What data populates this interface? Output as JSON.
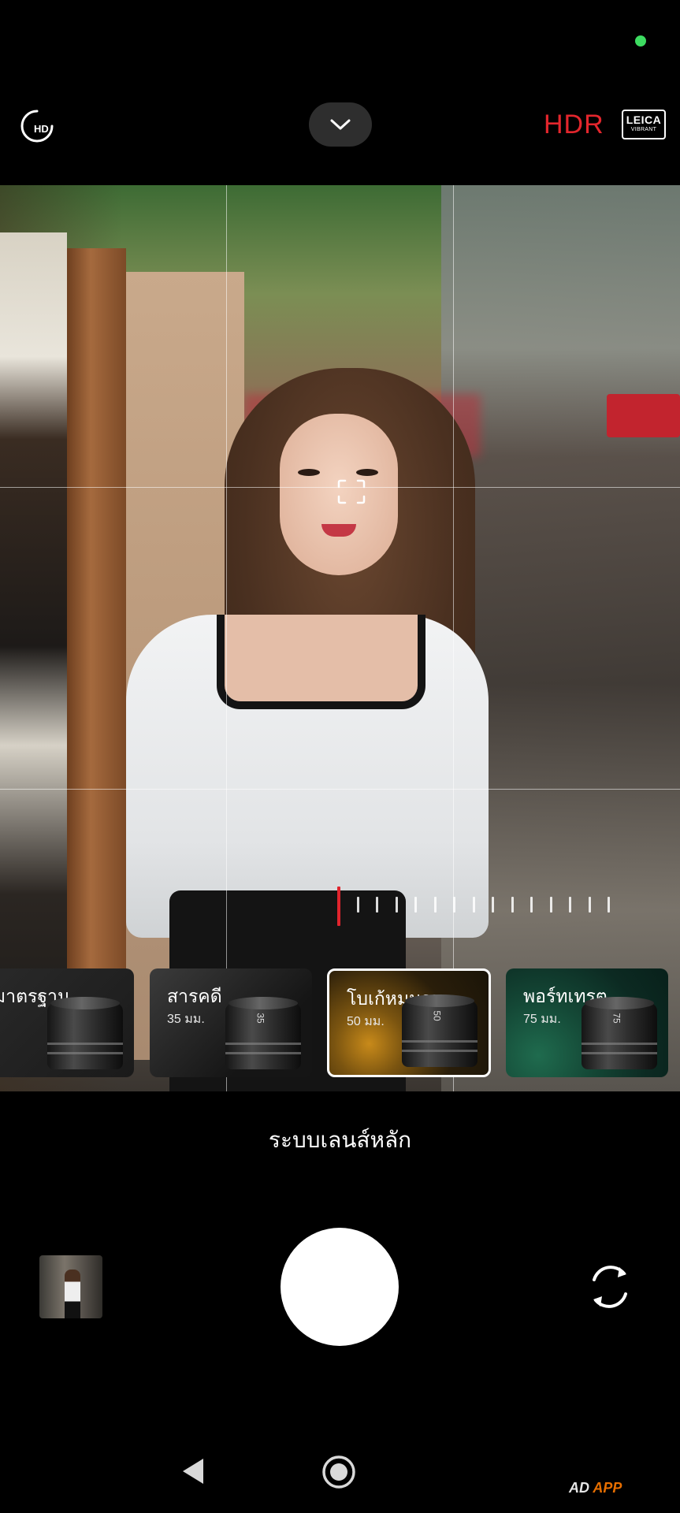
{
  "colors": {
    "status_dot": "#3ddc61",
    "hdr_active": "#e3262d",
    "zoom_indicator": "#e0242d",
    "selected_border": "#ffffff"
  },
  "top_bar": {
    "hd_icon_text": "HD",
    "hdr_label": "HDR",
    "leica_brand": "LEICA",
    "leica_mode": "VIBRANT"
  },
  "lenses": [
    {
      "name": "มาตรฐาน",
      "focal": "",
      "lens_mark": "",
      "bg": "linear-gradient(135deg,#2a2a2a,#1a1a1a)"
    },
    {
      "name": "สารคดี",
      "focal": "35 มม.",
      "lens_mark": "35",
      "bg": "linear-gradient(135deg,#3b3b3b,#151515 70%)"
    },
    {
      "name": "โบเก้หมุนวน",
      "focal": "50 มม.",
      "lens_mark": "50",
      "bg": "radial-gradient(circle at 25% 70%,#c88a1a 0,#7a5410 25%,#2a1e0a 60%,#1a1408)"
    },
    {
      "name": "พอร์ทเทรต",
      "focal": "75 มม.",
      "lens_mark": "75",
      "bg": "radial-gradient(circle at 20% 80%,#1f6b4e 0,#144836 35%,#0c2a22 70%,#08201a)"
    }
  ],
  "selected_lens_index": 2,
  "mode_label": "ระบบเลนส์หลัก",
  "zoom": {
    "tick_count": 15,
    "active_tick": 0
  },
  "watermark": {
    "prefix": "AD",
    "suffix": "APP"
  },
  "icons": {
    "hd": "hd-quality-icon",
    "chevron": "chevron-down-icon",
    "focus": "focus-frame-icon",
    "flip": "switch-camera-icon",
    "back": "nav-back-icon",
    "home": "nav-home-icon"
  }
}
